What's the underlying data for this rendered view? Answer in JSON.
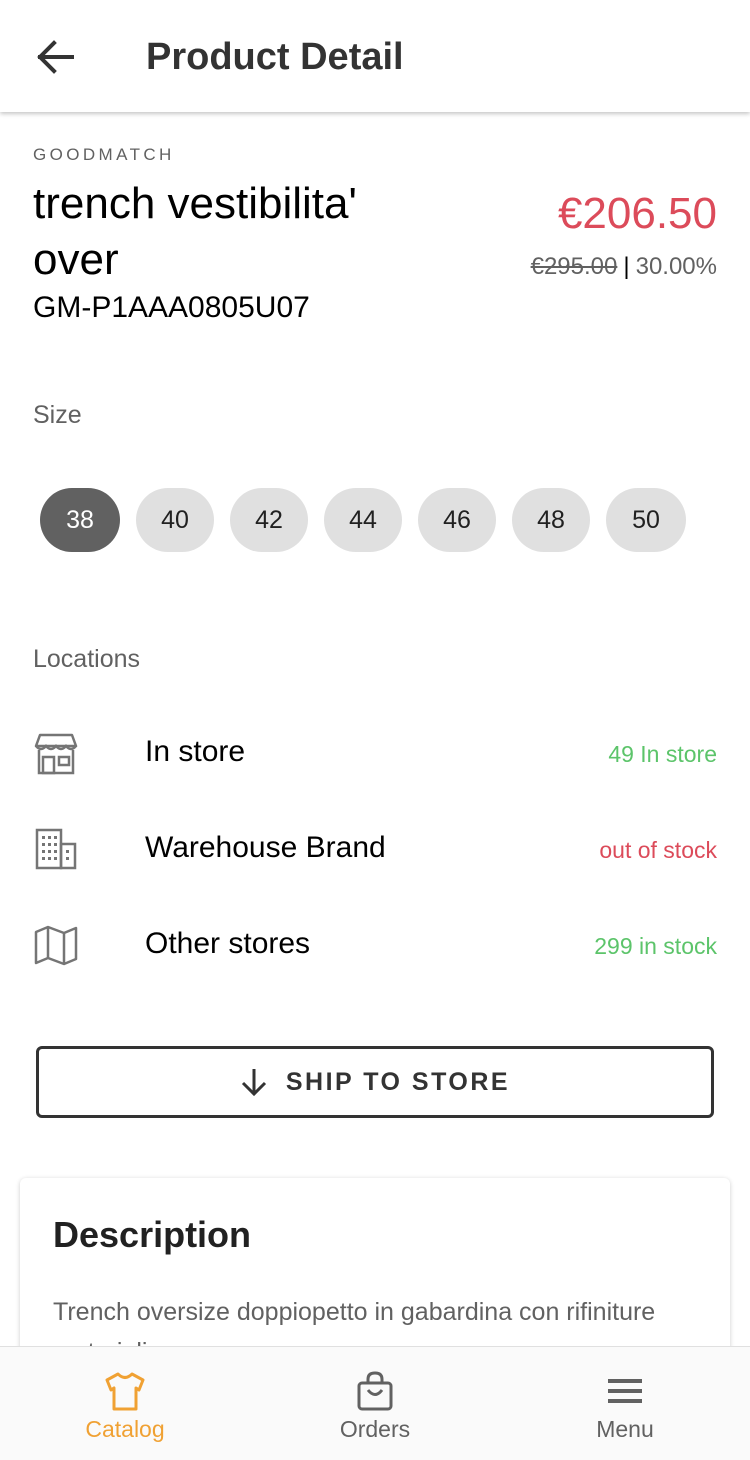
{
  "header": {
    "title": "Product Detail"
  },
  "product": {
    "brand": "GOODMATCH",
    "name": "trench vestibilita' over",
    "sku": "GM-P1AAA0805U07",
    "price": "€206.50",
    "original_price": "€295.00",
    "separator": "|",
    "discount": "30.00%"
  },
  "size_section": {
    "label": "Size",
    "options": [
      "38",
      "40",
      "42",
      "44",
      "46",
      "48",
      "50"
    ],
    "selected": "38"
  },
  "locations_section": {
    "label": "Locations",
    "items": [
      {
        "name": "In store",
        "status": "49 In store",
        "status_color": "#5cc46a",
        "icon": "store-icon"
      },
      {
        "name": "Warehouse Brand",
        "status": "out of stock",
        "status_color": "#dc4b5a",
        "icon": "building-icon"
      },
      {
        "name": "Other stores",
        "status": "299 in stock",
        "status_color": "#5cc46a",
        "icon": "map-icon"
      }
    ]
  },
  "ship_button": {
    "label": "SHIP TO STORE",
    "icon": "arrow-down-icon"
  },
  "description": {
    "title": "Description",
    "text": "Trench oversize doppiopetto in gabardina con rifiniture materiali..."
  },
  "bottom_nav": {
    "items": [
      {
        "label": "Catalog",
        "icon": "shirt-icon",
        "active": true
      },
      {
        "label": "Orders",
        "icon": "shopping-bag-icon",
        "active": false
      },
      {
        "label": "Menu",
        "icon": "hamburger-menu-icon",
        "active": false
      }
    ]
  },
  "colors": {
    "accent": "#f0a133",
    "price": "#dc4b5a",
    "in_stock": "#5cc46a",
    "chip_selected": "#616161",
    "chip": "#e0e0e0"
  }
}
